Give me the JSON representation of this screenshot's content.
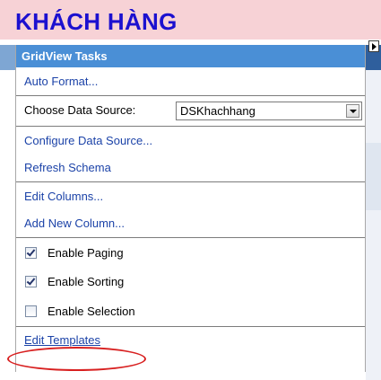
{
  "page_heading": "KHÁCH HÀNG",
  "panel": {
    "header": "GridView Tasks",
    "auto_format": "Auto Format...",
    "data_source": {
      "label": "Choose Data Source:",
      "selected": "DSKhachhang"
    },
    "configure": "Configure Data Source...",
    "refresh": "Refresh Schema",
    "edit_columns": "Edit Columns...",
    "add_column": "Add New Column...",
    "enable_paging": {
      "label": "Enable Paging",
      "checked": true
    },
    "enable_sorting": {
      "label": "Enable Sorting",
      "checked": true
    },
    "enable_selection": {
      "label": "Enable Selection",
      "checked": false
    },
    "edit_templates": "Edit Templates"
  },
  "colors": {
    "heading_text": "#1c10cf",
    "heading_band": "#f7d2d6",
    "panel_header": "#4a8fd6",
    "link": "#1c43a8",
    "highlight_ellipse": "#d82020"
  },
  "icons": {
    "smart_tag": "triangle-right-icon",
    "dropdown": "chevron-down-icon",
    "checkbox": "checkbox-icon"
  }
}
